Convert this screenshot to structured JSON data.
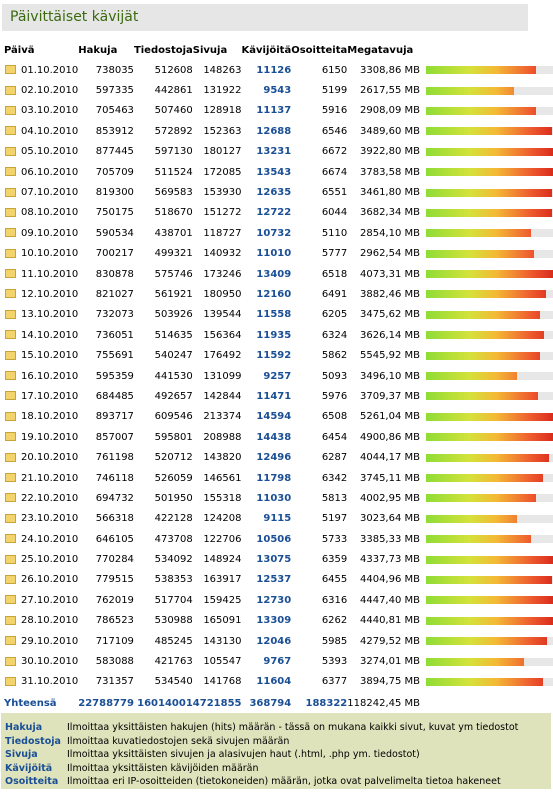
{
  "title": "Päivittäiset kävijät",
  "colors": {
    "link": "#1a4f96",
    "title": "#3b6a0e",
    "bar_low": "#8fdc36",
    "bar_high": "#d9281c",
    "legend_bg": "#dfe3bc"
  },
  "headers": {
    "date": "Päivä",
    "hakuja": "Hakuja",
    "tiedostoja": "Tiedostoja",
    "sivuja": "Sivuja",
    "kavijoita": "Kävijöitä",
    "osoitteita": "Osoitteita",
    "megatavuja": "Megatavuja"
  },
  "rows": [
    {
      "date": "01.10.2010",
      "hakuja": "738035",
      "tiedostoja": "512608",
      "sivuja": "148263",
      "kavijoita": "11126",
      "osoitteita": "6150",
      "mb": "3308,86 MB",
      "level": 0.75
    },
    {
      "date": "02.10.2010",
      "hakuja": "597335",
      "tiedostoja": "442861",
      "sivuja": "131922",
      "kavijoita": "9543",
      "osoitteita": "5199",
      "mb": "2617,55 MB",
      "level": 0.6
    },
    {
      "date": "03.10.2010",
      "hakuja": "705463",
      "tiedostoja": "507460",
      "sivuja": "128918",
      "kavijoita": "11137",
      "osoitteita": "5916",
      "mb": "2908,09 MB",
      "level": 0.75
    },
    {
      "date": "04.10.2010",
      "hakuja": "853912",
      "tiedostoja": "572892",
      "sivuja": "152363",
      "kavijoita": "12688",
      "osoitteita": "6546",
      "mb": "3489,60 MB",
      "level": 0.86
    },
    {
      "date": "05.10.2010",
      "hakuja": "877445",
      "tiedostoja": "597130",
      "sivuja": "180127",
      "kavijoita": "13231",
      "osoitteita": "6672",
      "mb": "3922,80 MB",
      "level": 0.91
    },
    {
      "date": "06.10.2010",
      "hakuja": "705709",
      "tiedostoja": "511524",
      "sivuja": "172085",
      "kavijoita": "13543",
      "osoitteita": "6674",
      "mb": "3783,58 MB",
      "level": 0.87
    },
    {
      "date": "07.10.2010",
      "hakuja": "819300",
      "tiedostoja": "569583",
      "sivuja": "153930",
      "kavijoita": "12635",
      "osoitteita": "6551",
      "mb": "3461,80 MB",
      "level": 0.86
    },
    {
      "date": "08.10.2010",
      "hakuja": "750175",
      "tiedostoja": "518670",
      "sivuja": "151272",
      "kavijoita": "12722",
      "osoitteita": "6044",
      "mb": "3682,34 MB",
      "level": 0.86
    },
    {
      "date": "09.10.2010",
      "hakuja": "590534",
      "tiedostoja": "438701",
      "sivuja": "118727",
      "kavijoita": "10732",
      "osoitteita": "5110",
      "mb": "2854,10 MB",
      "level": 0.72
    },
    {
      "date": "10.10.2010",
      "hakuja": "700217",
      "tiedostoja": "499321",
      "sivuja": "140932",
      "kavijoita": "11010",
      "osoitteita": "5777",
      "mb": "2962,54 MB",
      "level": 0.74
    },
    {
      "date": "11.10.2010",
      "hakuja": "830878",
      "tiedostoja": "575746",
      "sivuja": "173246",
      "kavijoita": "13409",
      "osoitteita": "6518",
      "mb": "4073,31 MB",
      "level": 0.91
    },
    {
      "date": "12.10.2010",
      "hakuja": "821027",
      "tiedostoja": "561921",
      "sivuja": "180950",
      "kavijoita": "12160",
      "osoitteita": "6491",
      "mb": "3882,46 MB",
      "level": 0.82
    },
    {
      "date": "13.10.2010",
      "hakuja": "732073",
      "tiedostoja": "503926",
      "sivuja": "139544",
      "kavijoita": "11558",
      "osoitteita": "6205",
      "mb": "3475,62 MB",
      "level": 0.78
    },
    {
      "date": "14.10.2010",
      "hakuja": "736051",
      "tiedostoja": "514635",
      "sivuja": "156364",
      "kavijoita": "11935",
      "osoitteita": "6324",
      "mb": "3626,14 MB",
      "level": 0.81
    },
    {
      "date": "15.10.2010",
      "hakuja": "755691",
      "tiedostoja": "540247",
      "sivuja": "176492",
      "kavijoita": "11592",
      "osoitteita": "5862",
      "mb": "5545,92 MB",
      "level": 0.78
    },
    {
      "date": "16.10.2010",
      "hakuja": "595359",
      "tiedostoja": "441530",
      "sivuja": "131099",
      "kavijoita": "9257",
      "osoitteita": "5093",
      "mb": "3496,10 MB",
      "level": 0.62
    },
    {
      "date": "17.10.2010",
      "hakuja": "684485",
      "tiedostoja": "492657",
      "sivuja": "142844",
      "kavijoita": "11471",
      "osoitteita": "5976",
      "mb": "3709,37 MB",
      "level": 0.77
    },
    {
      "date": "18.10.2010",
      "hakuja": "893717",
      "tiedostoja": "609546",
      "sivuja": "213374",
      "kavijoita": "14594",
      "osoitteita": "6508",
      "mb": "5261,04 MB",
      "level": 1.0
    },
    {
      "date": "19.10.2010",
      "hakuja": "857007",
      "tiedostoja": "595801",
      "sivuja": "208988",
      "kavijoita": "14438",
      "osoitteita": "6454",
      "mb": "4900,86 MB",
      "level": 0.99
    },
    {
      "date": "20.10.2010",
      "hakuja": "761198",
      "tiedostoja": "520712",
      "sivuja": "143820",
      "kavijoita": "12496",
      "osoitteita": "6287",
      "mb": "4044,17 MB",
      "level": 0.84
    },
    {
      "date": "21.10.2010",
      "hakuja": "746118",
      "tiedostoja": "526059",
      "sivuja": "146561",
      "kavijoita": "11798",
      "osoitteita": "6342",
      "mb": "3745,11 MB",
      "level": 0.8
    },
    {
      "date": "22.10.2010",
      "hakuja": "694732",
      "tiedostoja": "501950",
      "sivuja": "155318",
      "kavijoita": "11030",
      "osoitteita": "5813",
      "mb": "4002,95 MB",
      "level": 0.75
    },
    {
      "date": "23.10.2010",
      "hakuja": "566318",
      "tiedostoja": "422128",
      "sivuja": "124208",
      "kavijoita": "9115",
      "osoitteita": "5197",
      "mb": "3023,64 MB",
      "level": 0.62
    },
    {
      "date": "24.10.2010",
      "hakuja": "646105",
      "tiedostoja": "473708",
      "sivuja": "122706",
      "kavijoita": "10506",
      "osoitteita": "5733",
      "mb": "3385,33 MB",
      "level": 0.72
    },
    {
      "date": "25.10.2010",
      "hakuja": "770284",
      "tiedostoja": "534092",
      "sivuja": "148924",
      "kavijoita": "13075",
      "osoitteita": "6359",
      "mb": "4337,73 MB",
      "level": 0.9
    },
    {
      "date": "26.10.2010",
      "hakuja": "779515",
      "tiedostoja": "538353",
      "sivuja": "163917",
      "kavijoita": "12537",
      "osoitteita": "6455",
      "mb": "4404,96 MB",
      "level": 0.86
    },
    {
      "date": "27.10.2010",
      "hakuja": "762019",
      "tiedostoja": "517704",
      "sivuja": "159425",
      "kavijoita": "12730",
      "osoitteita": "6316",
      "mb": "4447,40 MB",
      "level": 0.87
    },
    {
      "date": "28.10.2010",
      "hakuja": "786523",
      "tiedostoja": "530988",
      "sivuja": "165091",
      "kavijoita": "13309",
      "osoitteita": "6262",
      "mb": "4440,81 MB",
      "level": 0.91
    },
    {
      "date": "29.10.2010",
      "hakuja": "717109",
      "tiedostoja": "485245",
      "sivuja": "143130",
      "kavijoita": "12046",
      "osoitteita": "5985",
      "mb": "4279,52 MB",
      "level": 0.83
    },
    {
      "date": "30.10.2010",
      "hakuja": "583088",
      "tiedostoja": "421763",
      "sivuja": "105547",
      "kavijoita": "9767",
      "osoitteita": "5393",
      "mb": "3274,01 MB",
      "level": 0.67
    },
    {
      "date": "31.10.2010",
      "hakuja": "731357",
      "tiedostoja": "534540",
      "sivuja": "141768",
      "kavijoita": "11604",
      "osoitteita": "6377",
      "mb": "3894,75 MB",
      "level": 0.8
    }
  ],
  "total": {
    "label": "Yhteensä",
    "hakuja": "22788779",
    "tiedostoja": "16014001",
    "sivuja": "4721855",
    "kavijoita": "368794",
    "osoitteita": "188322",
    "mb": "118242,45 MB"
  },
  "legend": [
    {
      "key": "Hakuja",
      "desc": "Ilmoittaa yksittäisten hakujen (hits) määrän - tässä on mukana kaikki sivut, kuvat ym tiedostot"
    },
    {
      "key": "Tiedostoja",
      "desc": "Ilmoittaa kuvatiedostojen sekä sivujen määrän"
    },
    {
      "key": "Sivuja",
      "desc": "Ilmoittaa yksittäisten sivujen ja alasivujen haut (.html, .php ym. tiedostot)"
    },
    {
      "key": "Kävijöitä",
      "desc": "Ilmoittaa yksittäisten kävijöiden määrän"
    },
    {
      "key": "Osoitteita",
      "desc": "Ilmoittaa eri IP-osoitteiden (tietokoneiden) määrän, jotka ovat palvelimelta tietoa hakeneet"
    }
  ]
}
